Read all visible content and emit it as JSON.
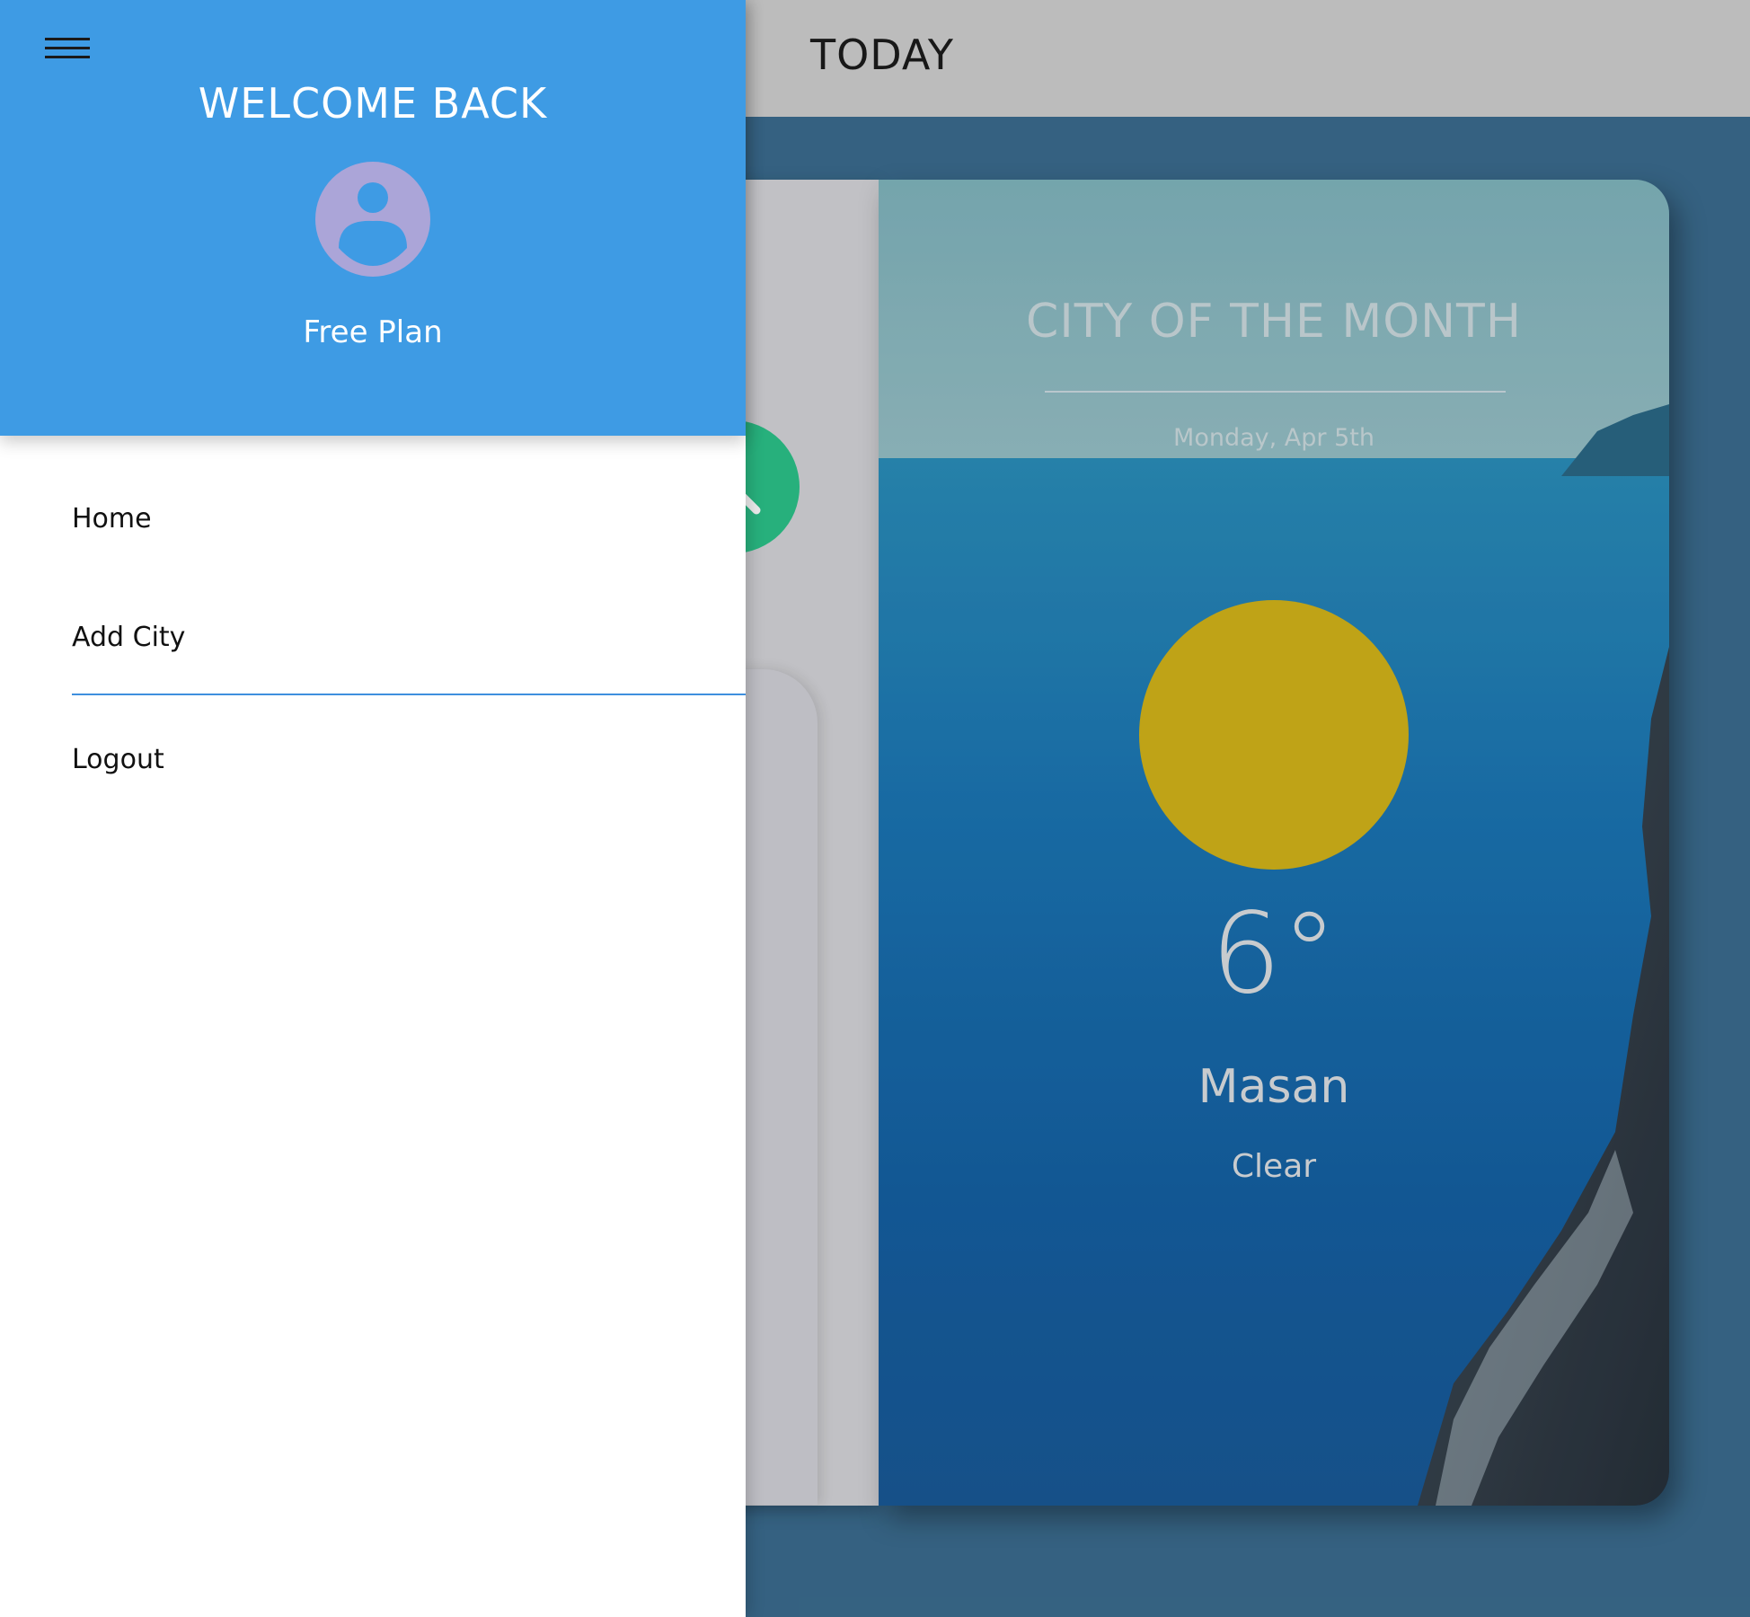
{
  "appbar": {
    "title": "TODAY"
  },
  "drawer": {
    "welcome": "WELCOME BACK",
    "plan": "Free Plan",
    "menu_icon": "hamburger-menu-icon",
    "avatar_icon": "account-circle-icon",
    "items": [
      {
        "label": "Home"
      },
      {
        "label": "Add City"
      },
      {
        "label": "Logout"
      }
    ]
  },
  "city_card": {
    "heading": "CITY OF THE MONTH",
    "date": "Monday, Apr 5th",
    "temperature": "6°",
    "city": "Masan",
    "condition": "Clear",
    "weather_icon": "sun-icon"
  },
  "colors": {
    "drawer_header": "#3e9be4",
    "appbar": "#cdcdcd",
    "sun": "#d0b11a",
    "fab": "#2bbf87",
    "avatar": "#aba5d8",
    "page_bg": "#3a6a8c"
  },
  "fab": {
    "icon": "search-icon"
  }
}
